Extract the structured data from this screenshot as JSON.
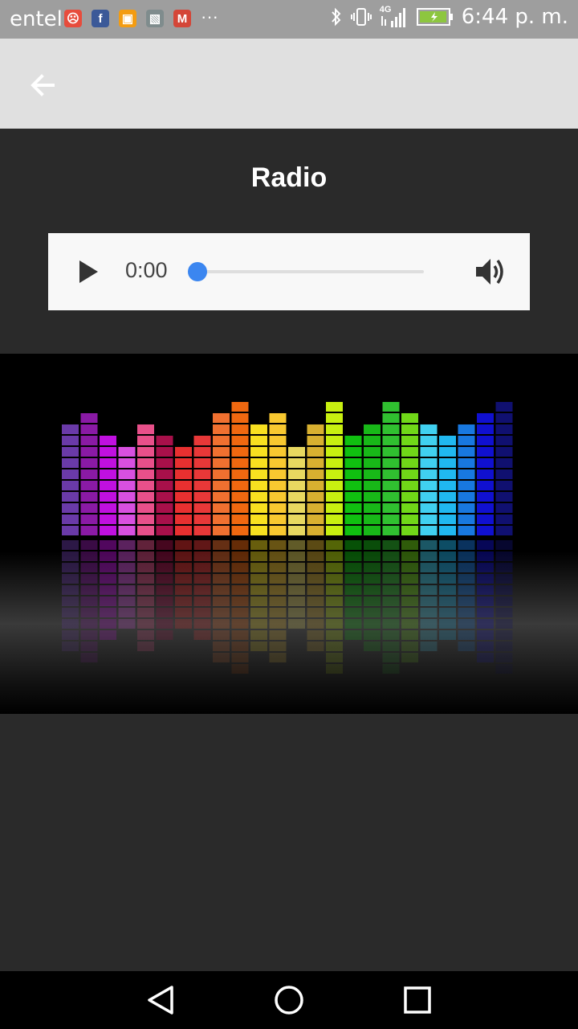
{
  "status_bar": {
    "carrier": "entel",
    "time": "6:44 p. m.",
    "network": "4G",
    "app_icons": [
      {
        "name": "sad-face-app-icon",
        "color": "#e74c3c",
        "glyph": "☹"
      },
      {
        "name": "facebook-icon",
        "color": "#3b5998",
        "glyph": "f"
      },
      {
        "name": "briefcase-app-icon",
        "color": "#f39c12",
        "glyph": "▣"
      },
      {
        "name": "gallery-icon",
        "color": "#7f8c8d",
        "glyph": "▧"
      },
      {
        "name": "gmail-icon",
        "color": "#d44638",
        "glyph": "M"
      }
    ],
    "more": "···"
  },
  "app_bar": {
    "back_icon": "arrow-back-icon"
  },
  "main": {
    "title": "Radio",
    "player": {
      "time": "0:00",
      "progress": 0,
      "accent": "#3b86f0",
      "play_icon": "play-icon",
      "volume_icon": "volume-icon"
    },
    "equalizer": {
      "levels": [
        10,
        11,
        9,
        8,
        10,
        9,
        8,
        9,
        11,
        12,
        10,
        11,
        8,
        10,
        12,
        9,
        10,
        12,
        11,
        10,
        9,
        10,
        11,
        12
      ],
      "colors": [
        "#6a3aa8",
        "#8a1aa5",
        "#c010e0",
        "#d850e0",
        "#e8508a",
        "#a8104a",
        "#e83030",
        "#e83838",
        "#f07030",
        "#f06810",
        "#f8e020",
        "#f8c830",
        "#e8d860",
        "#d8b030",
        "#c8f010",
        "#10c010",
        "#18b818",
        "#30c030",
        "#70d818",
        "#40d0f0",
        "#20b8f0",
        "#1878e0",
        "#1010d0",
        "#101070"
      ]
    }
  },
  "nav_bar": {
    "back": "nav-back-icon",
    "home": "nav-home-icon",
    "recents": "nav-recents-icon"
  }
}
